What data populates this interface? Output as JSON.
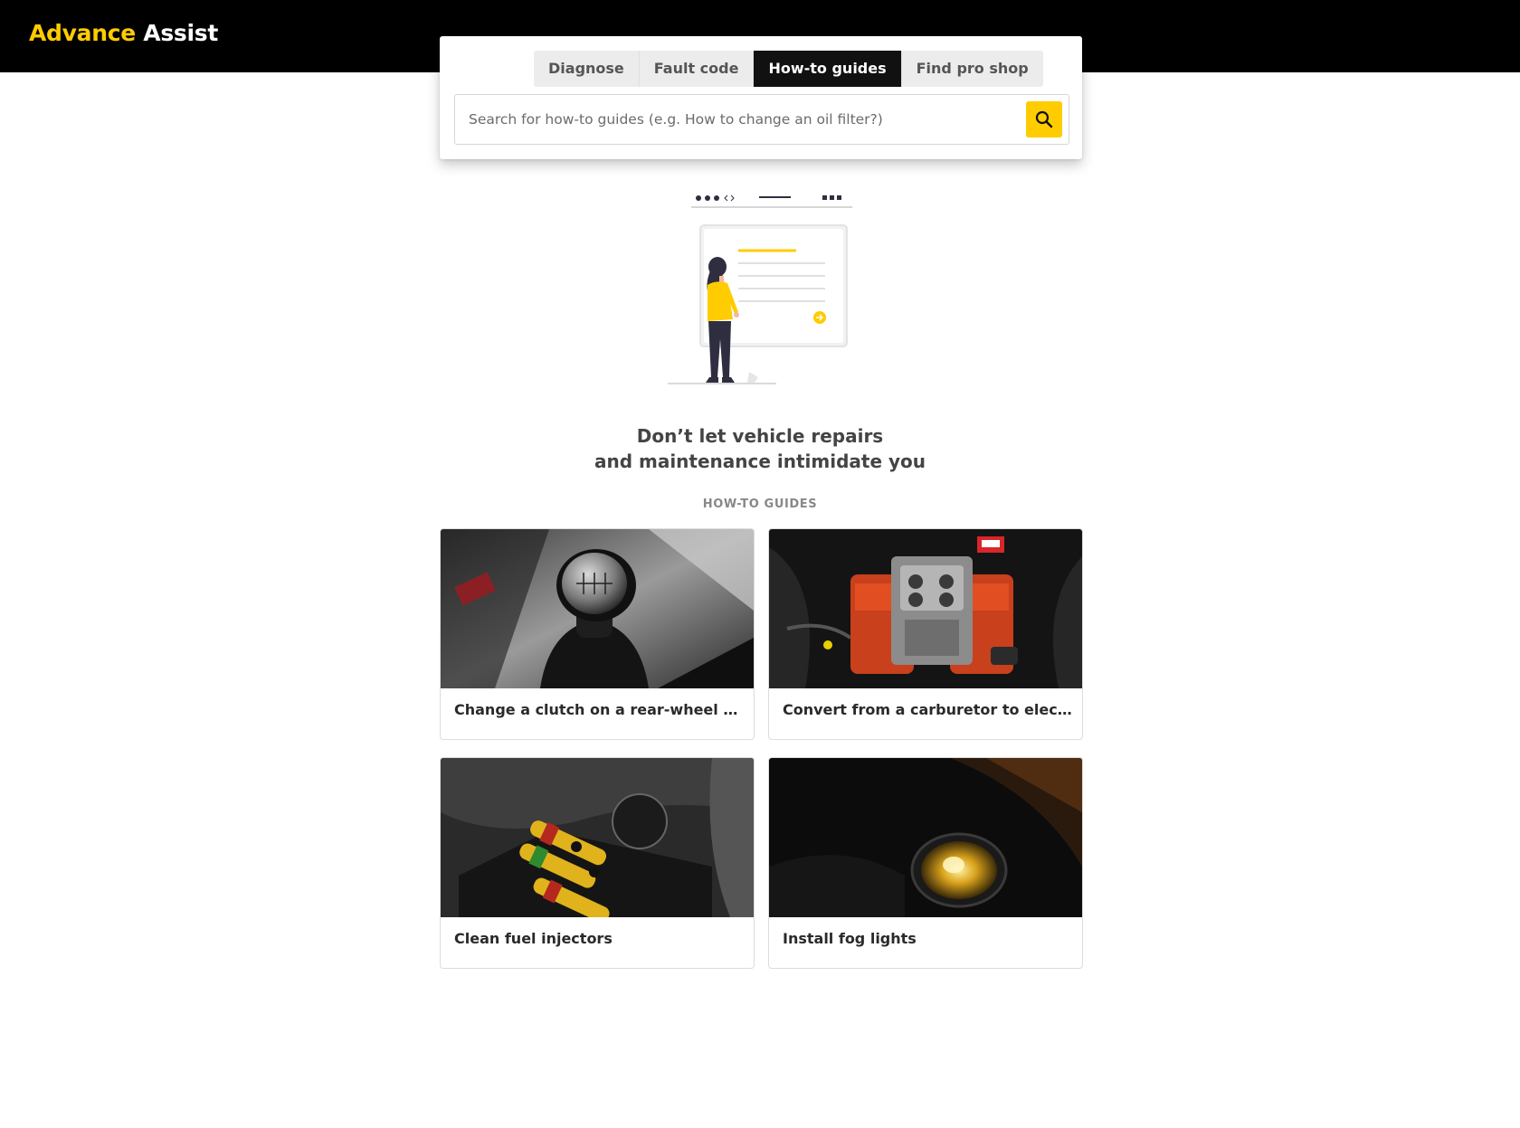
{
  "header": {
    "brand_part1": "Advance",
    "brand_part2": "Assist",
    "brand_color": "#ffcc00"
  },
  "search_panel": {
    "tabs": [
      {
        "label": "Diagnose",
        "active": false
      },
      {
        "label": "Fault code",
        "active": false
      },
      {
        "label": "How-to guides",
        "active": true
      },
      {
        "label": "Find pro shop",
        "active": false
      }
    ],
    "search": {
      "placeholder": "Search for how-to guides (e.g. How to change an oil filter?)",
      "value": "",
      "button_icon": "search-icon"
    }
  },
  "hero": {
    "illustration": "woman-reading-board-illustration",
    "headline_line1": "Don’t let vehicle repairs",
    "headline_line2": "and maintenance intimidate you"
  },
  "guides": {
    "section_label": "HOW-TO GUIDES",
    "items": [
      {
        "title": "Change a clutch on a rear-wheel drive...",
        "image": "gear-shifter-photo"
      },
      {
        "title": "Convert from a carburetor to electron...",
        "image": "carburetor-engine-photo"
      },
      {
        "title": "Clean fuel injectors",
        "image": "fuel-injectors-photo"
      },
      {
        "title": "Install fog lights",
        "image": "fog-light-photo"
      }
    ]
  },
  "colors": {
    "accent": "#ffcc00",
    "topbar": "#000000",
    "active_tab": "#111111",
    "tab_bg": "#ececec"
  }
}
